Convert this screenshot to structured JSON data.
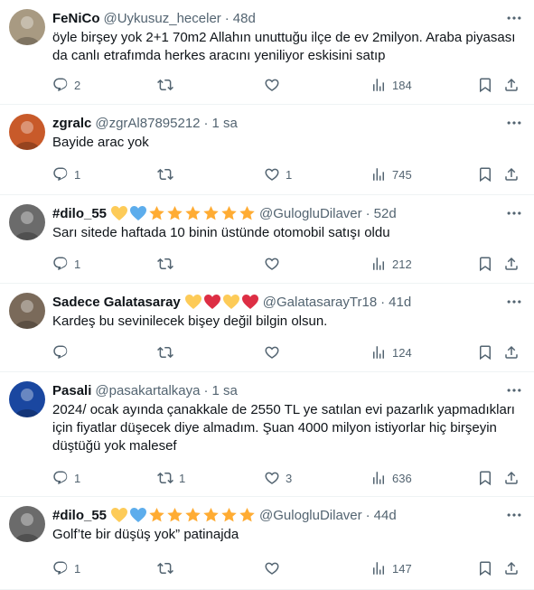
{
  "tweets": [
    {
      "name": "FeNiCo",
      "handle": "@Uykusuz_heceler",
      "time": "48d",
      "text": "öyle birşey yok 2+1 70m2 Allahın unuttuğu ilçe de ev 2milyon. Araba piyasası da canlı etrafımda herkes aracını yeniliyor eskisini satıp",
      "replies": "2",
      "retweets": "",
      "likes": "",
      "views": "184",
      "avatar_color": "#a89a82",
      "emojis": []
    },
    {
      "name": "zgralc",
      "handle": "@zgrAl87895212",
      "time": "1 sa",
      "text": "Bayide arac yok",
      "replies": "1",
      "retweets": "",
      "likes": "1",
      "views": "745",
      "avatar_color": "#c85a2a",
      "emojis": []
    },
    {
      "name": "#dilo_55",
      "handle": "@GulogluDilaver",
      "time": "52d",
      "text": "Sarı sitede haftada 10 binin üstünde otomobil satışı oldu",
      "replies": "1",
      "retweets": "",
      "likes": "",
      "views": "212",
      "avatar_color": "#6b6b6b",
      "emojis": [
        "yellow-heart",
        "blue-heart",
        "star",
        "star",
        "star",
        "star",
        "star",
        "star"
      ]
    },
    {
      "name": "Sadece Galatasaray",
      "handle": "@GalatasarayTr18",
      "time": "41d",
      "text": "Kardeş bu sevinilecek bişey değil bilgin olsun.",
      "replies": "",
      "retweets": "",
      "likes": "",
      "views": "124",
      "avatar_color": "#7a6a5a",
      "emojis": [
        "yellow-heart",
        "red-heart",
        "yellow-heart",
        "red-heart"
      ]
    },
    {
      "name": "Pasali",
      "handle": "@pasakartalkaya",
      "time": "1 sa",
      "text": "2024/ ocak ayında çanakkale de 2550 TL ye satılan evi pazarlık yapmadıkları için fiyatlar düşecek diye almadım. Şuan 4000 milyon istiyorlar hiç birşeyin düştüğü yok malesef",
      "replies": "1",
      "retweets": "1",
      "likes": "3",
      "views": "636",
      "avatar_color": "#1a47a0",
      "emojis": []
    },
    {
      "name": "#dilo_55",
      "handle": "@GulogluDilaver",
      "time": "44d",
      "text": "Golf’te bir düşüş yok” patinajda",
      "replies": "1",
      "retweets": "",
      "likes": "",
      "views": "147",
      "avatar_color": "#6b6b6b",
      "emojis": [
        "yellow-heart",
        "blue-heart",
        "star",
        "star",
        "star",
        "star",
        "star",
        "star"
      ]
    }
  ],
  "colors": {
    "text_primary": "#0f1419",
    "text_secondary": "#536471",
    "divider": "#eff3f4"
  },
  "icons": [
    "reply-icon",
    "retweet-icon",
    "like-icon",
    "views-icon",
    "bookmark-icon",
    "share-icon",
    "more-icon"
  ]
}
